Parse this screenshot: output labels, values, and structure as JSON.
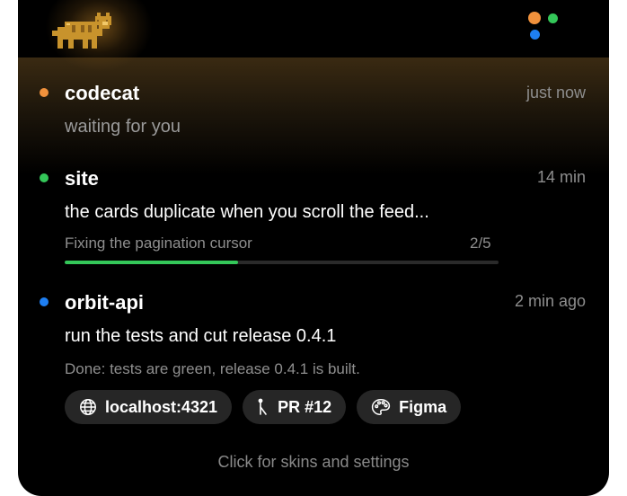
{
  "colors": {
    "orange": "#f0913c",
    "green": "#34c759",
    "blue": "#1e7ff2",
    "panel": "#000000"
  },
  "sessions": [
    {
      "name": "codecat",
      "time": "just now",
      "status_color": "orange",
      "message": "waiting for you"
    },
    {
      "name": "site",
      "time": "14 min",
      "status_color": "green",
      "message": "the cards duplicate when you scroll the feed...",
      "task": "Fixing the pagination cursor",
      "step": "2/5",
      "progress": 0.4
    },
    {
      "name": "orbit-api",
      "time": "2 min ago",
      "status_color": "blue",
      "message": "run the tests and cut release 0.4.1",
      "result": "Done: tests are green, release 0.4.1 is built.",
      "links": [
        {
          "icon": "globe-icon",
          "label": "localhost:4321"
        },
        {
          "icon": "pull-request-icon",
          "label": "PR #12"
        },
        {
          "icon": "palette-icon",
          "label": "Figma"
        }
      ]
    }
  ],
  "footer": "Click for skins and settings"
}
